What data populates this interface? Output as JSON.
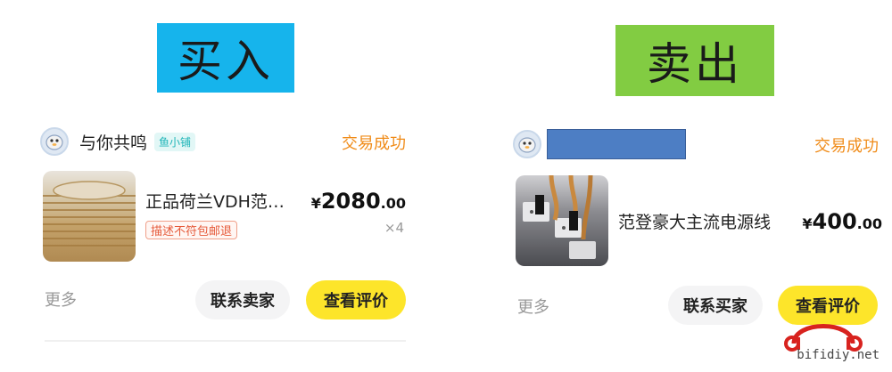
{
  "banners": {
    "buy": "买入",
    "sell": "卖出"
  },
  "left_order": {
    "shop_name": "与你共鸣",
    "shop_tag": "鱼小铺",
    "status": "交易成功",
    "product_title": "正品荷兰VDH范…",
    "badge": "描述不符包邮退",
    "price_symbol": "¥",
    "price_integer": "2080",
    "price_decimal": ".00",
    "quantity": "×4",
    "more": "更多",
    "contact_button": "联系卖家",
    "review_button": "查看评价"
  },
  "right_order": {
    "status": "交易成功",
    "product_title": "范登豪大主流电源线",
    "price_symbol": "¥",
    "price_integer": "400",
    "price_decimal": ".00",
    "more": "更多",
    "contact_button": "联系买家",
    "review_button": "查看评价"
  },
  "watermark": "bifidiy.net",
  "colors": {
    "buy_banner": "#16b4ec",
    "sell_banner": "#82cc42",
    "status": "#f08c1a",
    "review_button": "#fde52a",
    "redaction": "#4d7ec4",
    "logo_red": "#d8231f"
  },
  "icons": {
    "avatar": "fish-avatar-icon",
    "logo": "headphones-logo-icon"
  }
}
